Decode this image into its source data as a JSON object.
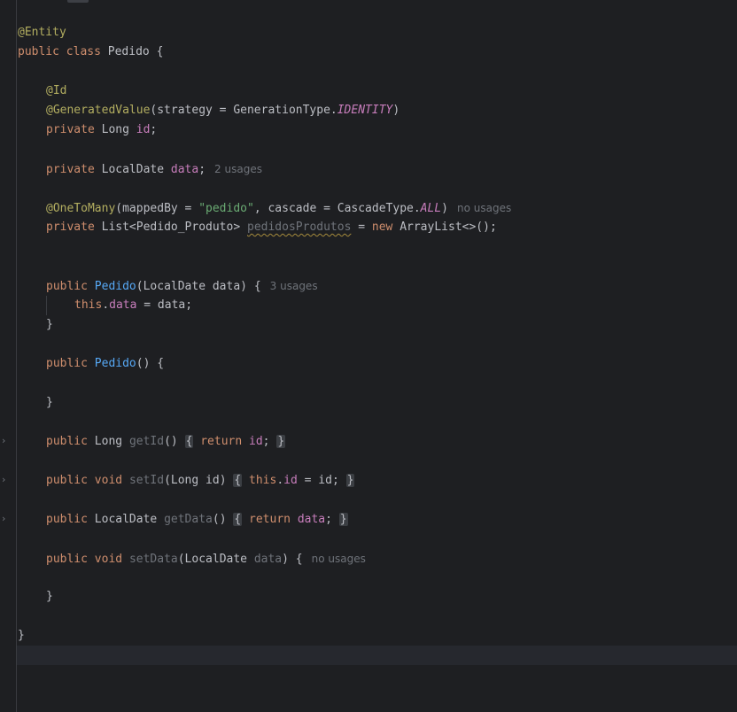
{
  "editor": {
    "lines": {
      "l1": {
        "ann": "@Entity"
      },
      "l2": {
        "kw1": "public",
        "kw2": "class",
        "name": "Pedido",
        "brace": "{"
      },
      "l3": {
        "ann": "@Id"
      },
      "l4": {
        "ann": "@GeneratedValue",
        "open": "(strategy = GenerationType.",
        "enum": "IDENTITY",
        "close": ")"
      },
      "l5": {
        "kw": "private",
        "type": "Long",
        "field": "id",
        "semi": ";"
      },
      "l6": {
        "kw": "private",
        "type": "LocalDate",
        "field": "data",
        "semi": ";",
        "hint": "2 usages"
      },
      "l7": {
        "ann": "@OneToMany",
        "open": "(mappedBy = ",
        "str": "\"pedido\"",
        "mid": ", cascade = CascadeType.",
        "enum": "ALL",
        "close": ")",
        "hint": "no usages"
      },
      "l8": {
        "kw": "private",
        "type": "List<Pedido_Produto>",
        "field": "pedidosProdutos",
        "eq": " = ",
        "kwnew": "new",
        "rest": "ArrayList<>();"
      },
      "l9": {
        "kw": "public",
        "name": "Pedido",
        "params": "(LocalDate data) {",
        "hint": "3 usages"
      },
      "l10": {
        "this": "this",
        "dot": ".",
        "field": "data",
        "rest": " = data;"
      },
      "l11": {
        "brace": "}"
      },
      "l12": {
        "kw": "public",
        "name": "Pedido",
        "rest": "() {"
      },
      "l13": {
        "brace": "}"
      },
      "l14": {
        "kw": "public",
        "type": "Long",
        "name": "getId",
        "parens": "()",
        "ob": "{",
        "ret": "return",
        "field": "id",
        "semi": ";",
        "cb": "}"
      },
      "l15": {
        "kw": "public",
        "type": "void",
        "name": "setId",
        "params": "(Long id)",
        "ob": "{",
        "this": "this",
        "dot": ".",
        "field": "id",
        "rest": " = id;",
        "cb": "}"
      },
      "l16": {
        "kw": "public",
        "type": "LocalDate",
        "name": "getData",
        "parens": "()",
        "ob": "{",
        "ret": "return",
        "field": "data",
        "semi": ";",
        "cb": "}"
      },
      "l17": {
        "kw": "public",
        "type": "void",
        "name": "setData",
        "popen": "(LocalDate ",
        "param": "data",
        "pclose": ") {",
        "hint": "no usages"
      },
      "l18": {
        "brace": "}"
      },
      "l19": {
        "brace": "}"
      }
    },
    "fold_icon": "chevron-right-icon",
    "colors": {
      "background": "#1e1f22",
      "keyword": "#cf8e6d",
      "annotation": "#b3ae60",
      "field": "#c77dbb",
      "method": "#56a8f5",
      "string": "#6aab73",
      "hint": "#6f737a"
    }
  }
}
